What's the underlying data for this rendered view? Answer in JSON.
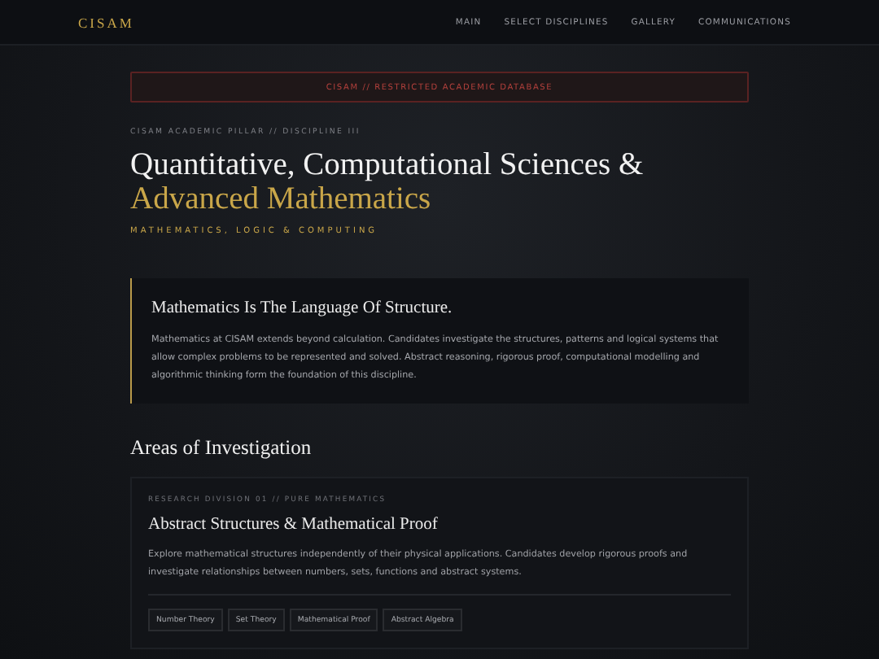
{
  "nav": {
    "logo": "CISAM",
    "links": [
      {
        "label": "MAIN"
      },
      {
        "label": "SELECT DISCIPLINES"
      },
      {
        "label": "GALLERY"
      },
      {
        "label": "COMMUNICATIONS"
      }
    ]
  },
  "banner": "CISAM // RESTRICTED ACADEMIC DATABASE",
  "hero": {
    "eyebrow": "CISAM ACADEMIC PILLAR // DISCIPLINE III",
    "title": "Quantitative, Computational Sciences &",
    "title_accent": "Advanced Mathematics",
    "subtitle": "MATHEMATICS, LOGIC & COMPUTING"
  },
  "intro": {
    "heading": "Mathematics Is The Language Of Structure.",
    "body": "Mathematics at CISAM extends beyond calculation. Candidates investigate the structures, patterns and logical systems that allow complex problems to be represented and solved. Abstract reasoning, rigorous proof, computational modelling and algorithmic thinking form the foundation of this discipline."
  },
  "section_title": "Areas of Investigation",
  "areas": [
    {
      "eyebrow": "RESEARCH DIVISION 01 // PURE MATHEMATICS",
      "title": "Abstract Structures & Mathematical Proof",
      "body": "Explore mathematical structures independently of their physical applications. Candidates develop rigorous proofs and investigate relationships between numbers, sets, functions and abstract systems.",
      "tags": [
        "Number Theory",
        "Set Theory",
        "Mathematical Proof",
        "Abstract Algebra"
      ]
    }
  ]
}
